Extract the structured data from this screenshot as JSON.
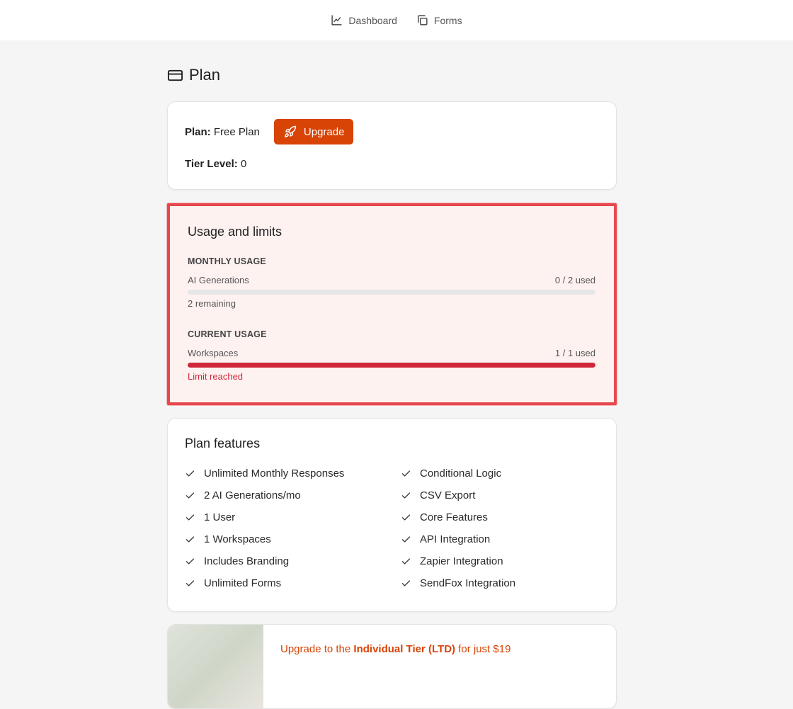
{
  "nav": {
    "items": [
      {
        "label": "Dashboard",
        "icon": "line-chart-icon"
      },
      {
        "label": "Forms",
        "icon": "copy-icon"
      }
    ]
  },
  "page": {
    "title": "Plan",
    "icon": "credit-card-icon"
  },
  "plan_card": {
    "plan_label": "Plan:",
    "plan_value": "Free Plan",
    "upgrade_label": "Upgrade",
    "tier_label": "Tier Level:",
    "tier_value": "0"
  },
  "usage": {
    "title": "Usage and limits",
    "monthly": {
      "section": "MONTHLY USAGE",
      "name": "AI Generations",
      "used_text": "0 / 2 used",
      "fraction": 0,
      "note": "2 remaining"
    },
    "current": {
      "section": "CURRENT USAGE",
      "name": "Workspaces",
      "used_text": "1 / 1 used",
      "fraction": 1,
      "note": "Limit reached"
    },
    "colors": {
      "limit": "#d0263a",
      "track": "#e6e6e6",
      "highlight_border": "#e5484d"
    }
  },
  "features": {
    "title": "Plan features",
    "left": [
      "Unlimited Monthly Responses",
      "2 AI Generations/mo",
      "1 User",
      "1 Workspaces",
      "Includes Branding",
      "Unlimited Forms"
    ],
    "right": [
      "Conditional Logic",
      "CSV Export",
      "Core Features",
      "API Integration",
      "Zapier Integration",
      "SendFox Integration"
    ]
  },
  "promo": {
    "prefix": "Upgrade to the ",
    "tier": "Individual Tier (LTD)",
    "suffix": " for just $19"
  },
  "colors": {
    "accent": "#d84306"
  }
}
